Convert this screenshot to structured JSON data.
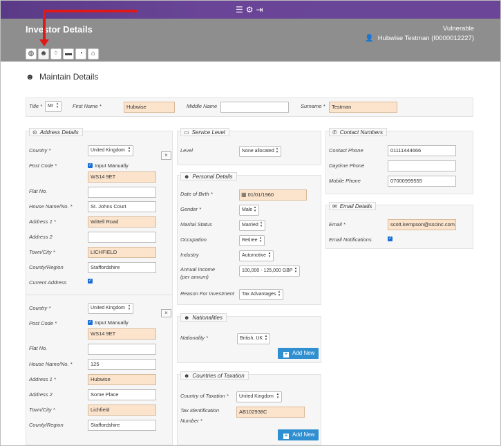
{
  "topbar": {
    "icons": [
      "menu-icon",
      "gear-icon",
      "logout-icon"
    ]
  },
  "header": {
    "title": "Investor Details",
    "vulnerable_label": "Vulnerable",
    "user_name": "Hubwise Testman (I0000012227)"
  },
  "tabs": [
    {
      "icon": "globe-icon"
    },
    {
      "icon": "person-icon"
    },
    {
      "icon": "group-icon"
    },
    {
      "icon": "folder-icon"
    },
    {
      "icon": "pie-chart-icon"
    },
    {
      "icon": "bank-icon"
    }
  ],
  "page": {
    "title": "Maintain Details"
  },
  "name_row": {
    "title_label": "Title *",
    "title_value": "Mr",
    "first_name_label": "First Name *",
    "first_name_value": "Hubwise",
    "middle_name_label": "Middle Name",
    "middle_name_value": "",
    "surname_label": "Surname *",
    "surname_value": "Testman"
  },
  "address": {
    "legend": "Address Details",
    "labels": {
      "country": "Country *",
      "post_code": "Post Code *",
      "flat": "Flat No.",
      "house": "House Name/No. *",
      "address1": "Address 1 *",
      "address2": "Address 2",
      "town": "Town/City *",
      "county": "County/Region",
      "current": "Current Address"
    },
    "input_manually_label": "Input Manually",
    "close": "×",
    "blocks": [
      {
        "country": "United Kingdom",
        "post_code": "WS14 9ET",
        "flat": "",
        "house": "St. Johns Court",
        "address1": "Wittell Road",
        "address2": "",
        "town": "LICHFIELD",
        "county": "Staffordshire"
      },
      {
        "country": "United Kingdom",
        "post_code": "WS14 9ET",
        "flat": "",
        "house": "125",
        "address1": "Hubwise",
        "address2": "Some Place",
        "town": "Lichfield",
        "county": "Staffordshire"
      }
    ]
  },
  "service": {
    "legend": "Service Level",
    "level_label": "Level",
    "level_value": "None allocated"
  },
  "personal": {
    "legend": "Personal Details",
    "dob_label": "Date of Birth *",
    "dob_value": "01/01/1960",
    "gender_label": "Gender *",
    "gender_value": "Male",
    "marital_label": "Marital Status",
    "marital_value": "Married",
    "occupation_label": "Occupation",
    "occupation_value": "Retiree",
    "industry_label": "Industry",
    "industry_value": "Automotive",
    "income_label_1": "Annual Income",
    "income_label_2": "(per annum)",
    "income_value": "100,000 - 125,000 GBP",
    "reason_label": "Reason For Investment",
    "reason_value": "Tax Advantages"
  },
  "nationalities": {
    "legend": "Nationalities",
    "label": "Nationality *",
    "value": "British, UK",
    "add_label": "Add New"
  },
  "taxation": {
    "legend": "Countries of Taxation",
    "country_label": "Country of Taxation *",
    "country_value": "United Kingdom",
    "tin_label_1": "Tax Identification",
    "tin_label_2": "Number *",
    "tin_value": "AB102938C",
    "add_label": "Add New"
  },
  "contact": {
    "legend": "Contact Numbers",
    "contact_label": "Contact Phone",
    "contact_value": "01111444666",
    "daytime_label": "Daytime Phone",
    "daytime_value": "",
    "mobile_label": "Mobile Phone",
    "mobile_value": "07000999555"
  },
  "email": {
    "legend": "Email Details",
    "email_label": "Email *",
    "email_value": "scott.kempson@sscinc.com",
    "notifications_label": "Email Notifications"
  },
  "colors": {
    "accent_purple": "#6a4597",
    "header_gray": "#8e8e8e",
    "required_fill": "#fbe3cc",
    "button_blue": "#2f8fd1",
    "annotation_red": "#e01818"
  }
}
